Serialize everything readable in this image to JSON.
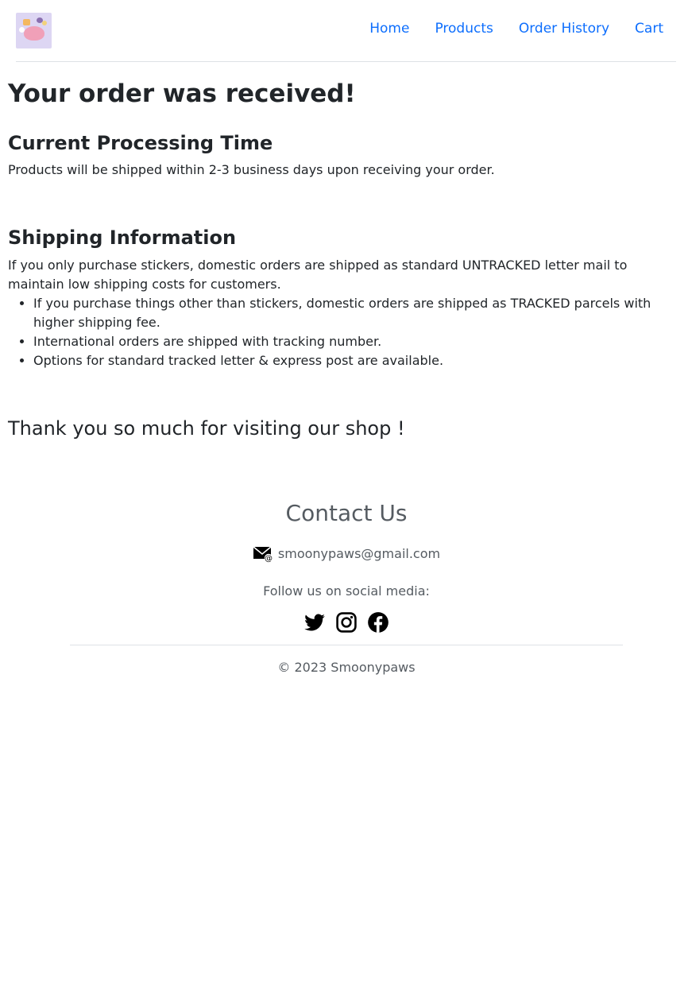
{
  "nav": {
    "logo_icon": "smoonypaws-logo",
    "items": [
      "Home",
      "Products",
      "Order History",
      "Cart"
    ]
  },
  "main": {
    "title": "Your order was received!",
    "processing": {
      "heading": "Current Processing Time",
      "text": "Products will be shipped within 2-3 business days upon receiving your order."
    },
    "shipping": {
      "heading": "Shipping Information",
      "text": "If you only purchase stickers, domestic orders are shipped as standard UNTRACKED letter mail to maintain low shipping costs for customers.",
      "list": [
        "If you purchase things other than stickers, domestic orders are shipped as TRACKED parcels with higher shipping fee.",
        "International orders are shipped with tracking number.",
        "Options for standard tracked letter & express post are available."
      ]
    },
    "thanks": "Thank you so much for visiting our shop !"
  },
  "footer": {
    "heading": "Contact Us",
    "email": "smoonypaws@gmail.com",
    "follow_text": "Follow us on social media:",
    "social_icons": [
      "twitter-icon",
      "instagram-icon",
      "facebook-icon"
    ],
    "copyright": "© 2023 Smoonypaws"
  },
  "colors": {
    "link": "#0d6efd",
    "text": "#212529",
    "footer_text": "#555b61",
    "divider": "#dee2e6"
  }
}
